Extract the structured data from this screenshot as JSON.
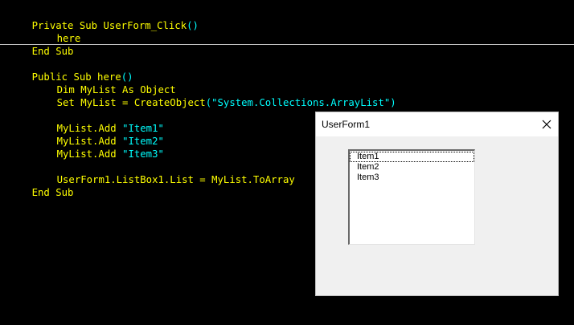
{
  "code": {
    "lines": [
      {
        "parts": [
          {
            "t": "Private Sub UserForm_Click",
            "c": "kw"
          },
          {
            "t": "()",
            "c": "paren"
          }
        ]
      },
      {
        "indent": 1,
        "parts": [
          {
            "t": "here",
            "c": "kw"
          }
        ]
      },
      {
        "parts": [
          {
            "t": "End Sub",
            "c": "kw"
          }
        ]
      },
      {
        "parts": [
          {
            "t": "Public Sub here",
            "c": "kw"
          },
          {
            "t": "()",
            "c": "paren"
          }
        ]
      },
      {
        "indent": 1,
        "parts": [
          {
            "t": "Dim MyList As Object",
            "c": "kw"
          }
        ]
      },
      {
        "indent": 1,
        "parts": [
          {
            "t": "Set MyList = CreateObject",
            "c": "kw"
          },
          {
            "t": "(\"System.Collections.ArrayList\")",
            "c": "str"
          }
        ]
      },
      {
        "indent": 1,
        "parts": [
          {
            "t": "MyList.Add ",
            "c": "kw"
          },
          {
            "t": "\"Item1\"",
            "c": "str"
          }
        ]
      },
      {
        "indent": 1,
        "parts": [
          {
            "t": "MyList.Add ",
            "c": "kw"
          },
          {
            "t": "\"Item2\"",
            "c": "str"
          }
        ]
      },
      {
        "indent": 1,
        "parts": [
          {
            "t": "MyList.Add ",
            "c": "kw"
          },
          {
            "t": "\"Item3\"",
            "c": "str"
          }
        ]
      },
      {
        "indent": 1,
        "parts": [
          {
            "t": "UserForm1.ListBox1.List = MyList.ToArray",
            "c": "kw"
          }
        ]
      },
      {
        "parts": [
          {
            "t": "End Sub",
            "c": "kw"
          }
        ]
      }
    ]
  },
  "userform": {
    "title": "UserForm1",
    "close_icon": "close-icon",
    "listbox": {
      "items": [
        "Item1",
        "Item2",
        "Item3"
      ]
    }
  },
  "colors": {
    "code_text": "#ffff00",
    "code_string": "#00ffff",
    "editor_background": "#000000"
  }
}
